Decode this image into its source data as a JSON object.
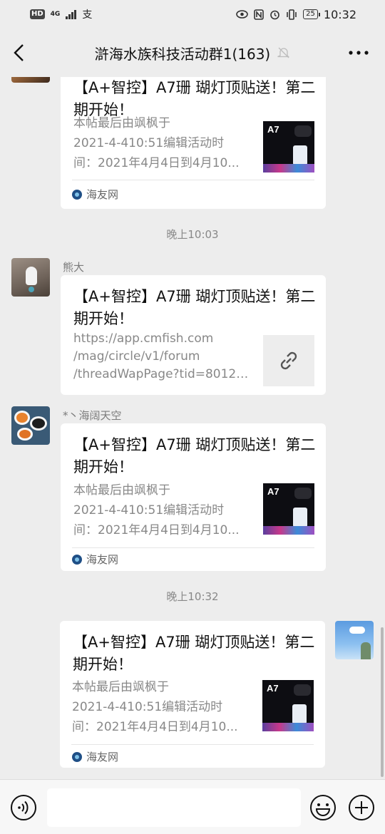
{
  "status_bar": {
    "hd": "HD",
    "network": "4G",
    "carrier_glyph": "支",
    "battery": "25",
    "time": "10:32"
  },
  "nav": {
    "title": "滸海水族科技活动群1(163)"
  },
  "messages": [
    {
      "kind": "card",
      "title": "【A+智控】A7珊 瑚灯顶贴送！第二期开始！",
      "desc": [
        "本帖最后由飒枫于",
        "2021-4-410:51编辑活动时",
        "间：2021年4月4日到4月10..."
      ],
      "thumb_label": "A7",
      "source": "海友网"
    },
    {
      "kind": "time",
      "text": "晚上10:03"
    },
    {
      "kind": "link_card",
      "sender": "熊大",
      "title": "【A+智控】A7珊 瑚灯顶贴送！第二期开始！",
      "desc": [
        "https://app.cmfish.com",
        "/mag/circle/v1/forum",
        "/threadWapPage?tid=80121..."
      ]
    },
    {
      "kind": "card",
      "sender": "*丶海阔天空",
      "title": "【A+智控】A7珊 瑚灯顶贴送！第二期开始！",
      "desc": [
        "本帖最后由飒枫于",
        "2021-4-410:51编辑活动时",
        "间：2021年4月4日到4月10..."
      ],
      "thumb_label": "A7",
      "source": "海友网"
    },
    {
      "kind": "time",
      "text": "晚上10:32"
    },
    {
      "kind": "card",
      "title": "【A+智控】A7珊 瑚灯顶贴送！第二期开始！",
      "desc": [
        "本帖最后由飒枫于",
        "2021-4-410:51编辑活动时",
        "间：2021年4月4日到4月10..."
      ],
      "thumb_label": "A7",
      "source": "海友网"
    }
  ],
  "input": {
    "placeholder": ""
  },
  "icons": {
    "back": "back-icon",
    "more": "more-icon",
    "mute": "mute-icon",
    "voice": "voice-icon",
    "emoji": "emoji-icon",
    "plus": "plus-icon",
    "link": "link-icon"
  },
  "colors": {
    "background": "#ededed",
    "card": "#ffffff",
    "source_icon": "#1f4f86"
  }
}
